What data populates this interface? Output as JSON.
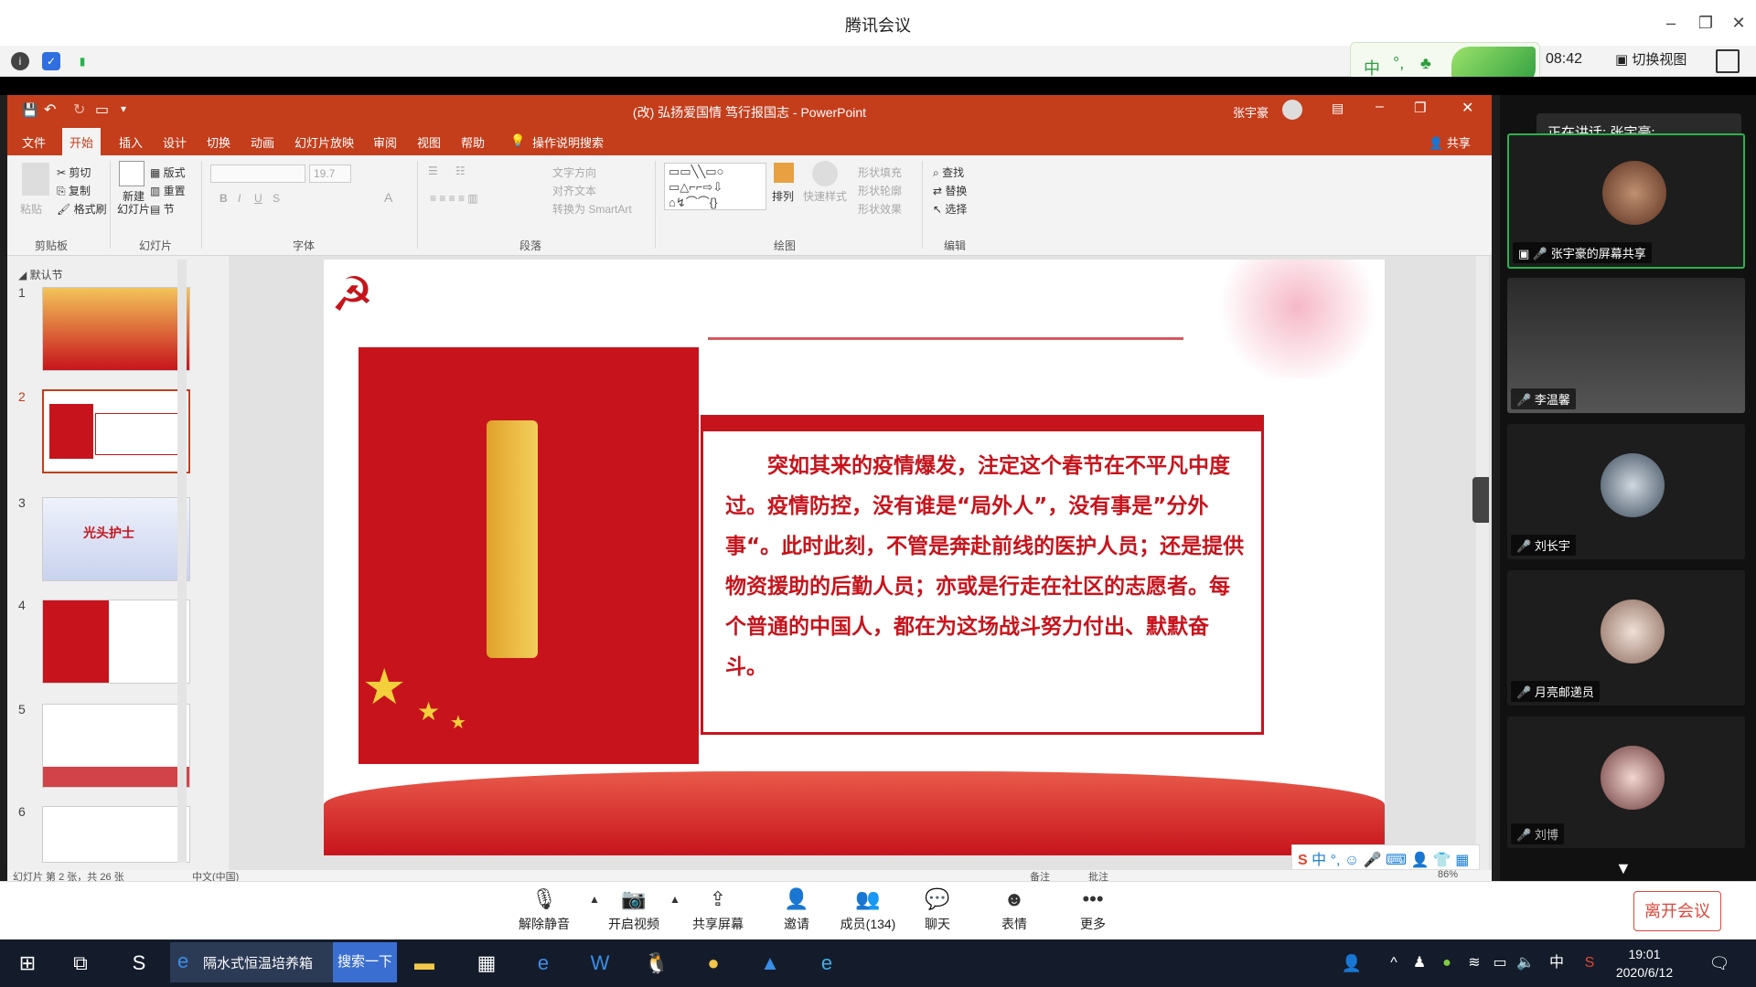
{
  "meeting": {
    "app_title": "腾讯会议",
    "time_elapsed": "08:42",
    "switch_view_label": "切换视图",
    "speaking_label": "正在讲话: 张宇豪;"
  },
  "ppt": {
    "window_title": "(改) 弘扬爱国情 笃行报国志 - PowerPoint",
    "user": "张宇豪",
    "share_label": "共享",
    "tabs": [
      "文件",
      "开始",
      "插入",
      "设计",
      "切换",
      "动画",
      "幻灯片放映",
      "审阅",
      "视图",
      "帮助"
    ],
    "tell_me": "操作说明搜索",
    "ribbon": {
      "clipboard": {
        "paste": "粘贴",
        "cut": "剪切",
        "copy": "复制",
        "format_painter": "格式刷",
        "label": "剪贴板"
      },
      "slides": {
        "new_slide": "新建\n幻灯片",
        "layout": "版式",
        "reset": "重置",
        "section": "节",
        "label": "幻灯片"
      },
      "font": {
        "size": "19.7",
        "label": "字体"
      },
      "paragraph": {
        "text_direction": "文字方向",
        "align_text": "对齐文本",
        "smartart": "转换为 SmartArt",
        "label": "段落"
      },
      "drawing": {
        "arrange": "排列",
        "quick_styles": "快速样式",
        "fill": "形状填充",
        "outline": "形状轮廓",
        "effects": "形状效果",
        "label": "绘图"
      },
      "editing": {
        "find": "查找",
        "replace": "替换",
        "select": "选择",
        "label": "编辑"
      }
    },
    "section_label": "默认节",
    "thumbnails": [
      "1",
      "2",
      "3",
      "4",
      "5",
      "6"
    ],
    "thumb3_text": "光头护士",
    "slide_text": "突如其来的疫情爆发，注定这个春节在不平凡中度过。疫情防控，没有谁是“局外人”，没有事是”分外事“。此时此刻，不管是奔赴前线的医护人员；还是提供物资援助的后勤人员；亦或是行走在社区的志愿者。每个普通的中国人，都在为这场战斗努力付出、默默奋斗。",
    "status": {
      "slide_info": "幻灯片 第 2 张，共 26 张",
      "language": "中文(中国)",
      "notes": "备注",
      "comments": "批注",
      "zoom": "86%"
    }
  },
  "participants": [
    {
      "name": "张宇豪的屏幕共享"
    },
    {
      "name": "李温馨"
    },
    {
      "name": "刘长宇"
    },
    {
      "name": "月亮邮递员"
    },
    {
      "name": "刘博"
    }
  ],
  "toolbar": {
    "unmute": "解除静音",
    "start_video": "开启视频",
    "share_screen": "共享屏幕",
    "invite": "邀请",
    "members": "成员(134)",
    "chat": "聊天",
    "reactions": "表情",
    "more": "更多",
    "leave": "离开会议"
  },
  "taskbar": {
    "browser_task": "隔水式恒温培养箱",
    "search_button": "搜索一下",
    "ime": "中",
    "time": "19:01",
    "date": "2020/6/12"
  }
}
